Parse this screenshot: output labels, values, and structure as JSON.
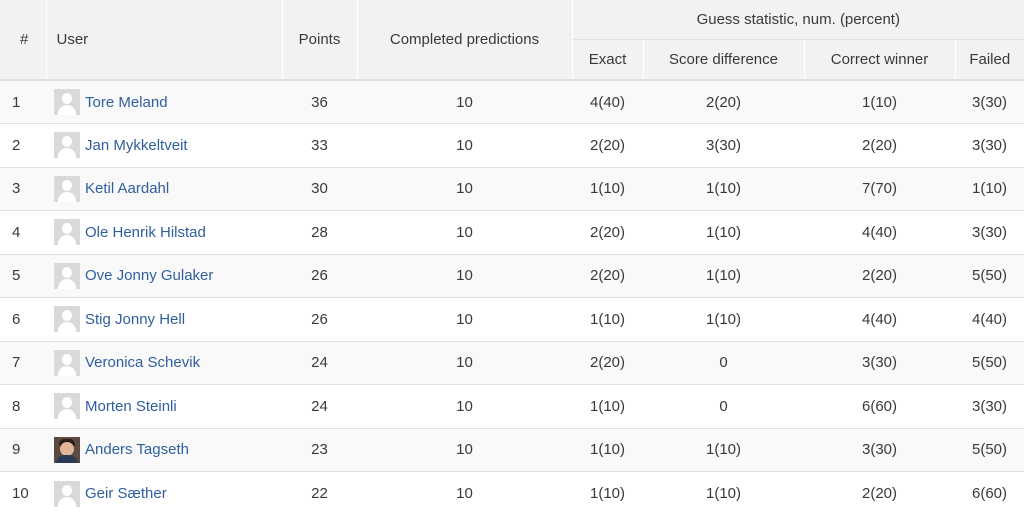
{
  "table": {
    "headers": {
      "rank": "#",
      "user": "User",
      "points": "Points",
      "completed": "Completed predictions",
      "group": "Guess statistic, num. (percent)",
      "exact": "Exact",
      "score_difference": "Score difference",
      "correct_winner": "Correct winner",
      "failed": "Failed"
    },
    "rows": [
      {
        "rank": "1",
        "user": "Tore Meland",
        "avatar": "default-user-icon",
        "points": "36",
        "completed": "10",
        "exact": "4(40)",
        "score_difference": "2(20)",
        "correct_winner": "1(10)",
        "failed": "3(30)"
      },
      {
        "rank": "2",
        "user": "Jan Mykkeltveit",
        "avatar": "default-user-icon",
        "points": "33",
        "completed": "10",
        "exact": "2(20)",
        "score_difference": "3(30)",
        "correct_winner": "2(20)",
        "failed": "3(30)"
      },
      {
        "rank": "3",
        "user": "Ketil Aardahl",
        "avatar": "default-user-icon",
        "points": "30",
        "completed": "10",
        "exact": "1(10)",
        "score_difference": "1(10)",
        "correct_winner": "7(70)",
        "failed": "1(10)"
      },
      {
        "rank": "4",
        "user": "Ole Henrik Hilstad",
        "avatar": "default-user-icon",
        "points": "28",
        "completed": "10",
        "exact": "2(20)",
        "score_difference": "1(10)",
        "correct_winner": "4(40)",
        "failed": "3(30)"
      },
      {
        "rank": "5",
        "user": "Ove Jonny Gulaker",
        "avatar": "default-user-icon",
        "points": "26",
        "completed": "10",
        "exact": "2(20)",
        "score_difference": "1(10)",
        "correct_winner": "2(20)",
        "failed": "5(50)"
      },
      {
        "rank": "6",
        "user": "Stig Jonny Hell",
        "avatar": "default-user-icon",
        "points": "26",
        "completed": "10",
        "exact": "1(10)",
        "score_difference": "1(10)",
        "correct_winner": "4(40)",
        "failed": "4(40)"
      },
      {
        "rank": "7",
        "user": "Veronica Schevik",
        "avatar": "default-user-icon",
        "points": "24",
        "completed": "10",
        "exact": "2(20)",
        "score_difference": "0",
        "correct_winner": "3(30)",
        "failed": "5(50)"
      },
      {
        "rank": "8",
        "user": "Morten Steinli",
        "avatar": "default-user-icon",
        "points": "24",
        "completed": "10",
        "exact": "1(10)",
        "score_difference": "0",
        "correct_winner": "6(60)",
        "failed": "3(30)"
      },
      {
        "rank": "9",
        "user": "Anders Tagseth",
        "avatar": "user-photo",
        "points": "23",
        "completed": "10",
        "exact": "1(10)",
        "score_difference": "1(10)",
        "correct_winner": "3(30)",
        "failed": "5(50)"
      },
      {
        "rank": "10",
        "user": "Geir Sæther",
        "avatar": "default-user-icon",
        "points": "22",
        "completed": "10",
        "exact": "1(10)",
        "score_difference": "1(10)",
        "correct_winner": "2(20)",
        "failed": "6(60)"
      }
    ]
  },
  "colors": {
    "link": "#2f5f9e",
    "header_bg": "#f2f2f2",
    "row_stripe": "#f9f9f9",
    "border": "#dee2e6"
  }
}
